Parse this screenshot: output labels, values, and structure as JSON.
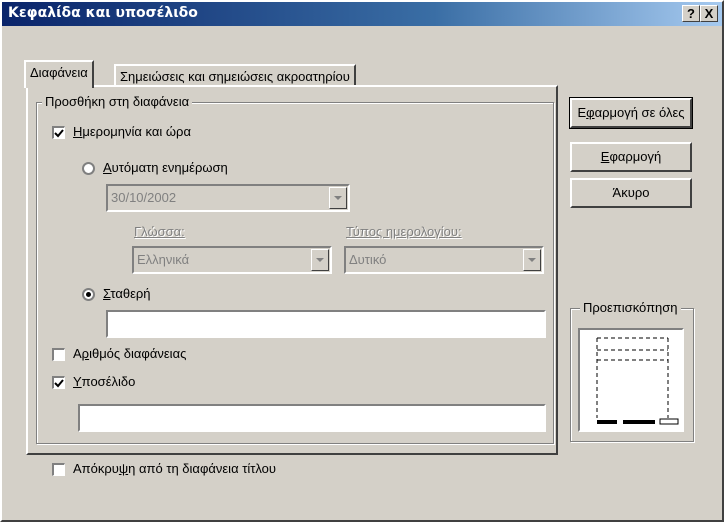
{
  "window": {
    "title": "Κεφαλίδα και υποσέλιδο",
    "help_label": "?",
    "close_label": "X"
  },
  "tabs": [
    {
      "label": "Διαφάνεια",
      "selected": true
    },
    {
      "label": "Σημειώσεις και σημειώσεις ακροατηρίου",
      "selected": false
    }
  ],
  "group": {
    "legend": "Προσθήκη στη διαφάνεια"
  },
  "datetime": {
    "label_ul": "Η",
    "label_rest": "μερομηνία και ώρα",
    "checked": true,
    "auto": {
      "label_ul": "Α",
      "label_rest": "υτόματη ενημέρωση",
      "selected": false,
      "date_value": "30/10/2002"
    },
    "language": {
      "label": "Γλώσσα:",
      "value": "Ελληνικά"
    },
    "calendar": {
      "label": "Τύπος ημερολογίου:",
      "value": "Δυτικό"
    },
    "fixed": {
      "label_ul": "Σ",
      "label_rest": "ταθερή",
      "selected": true,
      "value": ""
    }
  },
  "slide_number": {
    "label_pre": "Α",
    "label_ul": "ρ",
    "label_rest": "ιθμός διαφάνειας",
    "checked": false
  },
  "footer": {
    "label_ul": "Υ",
    "label_rest": "ποσέλιδο",
    "checked": true,
    "value": ""
  },
  "hide_title": {
    "label_pre": "Απόκρυ",
    "label_ul": "ψ",
    "label_rest": "η από τη διαφάνεια τίτλου",
    "checked": false
  },
  "buttons": {
    "apply_all": {
      "pre": "Ε",
      "ul": "φ",
      "rest": "αρμογή σε όλες"
    },
    "apply": {
      "pre": "",
      "ul": "Ε",
      "rest": "φαρμογή"
    },
    "cancel": "Άκυρο"
  },
  "preview": {
    "legend": "Προεπισκόπηση"
  }
}
